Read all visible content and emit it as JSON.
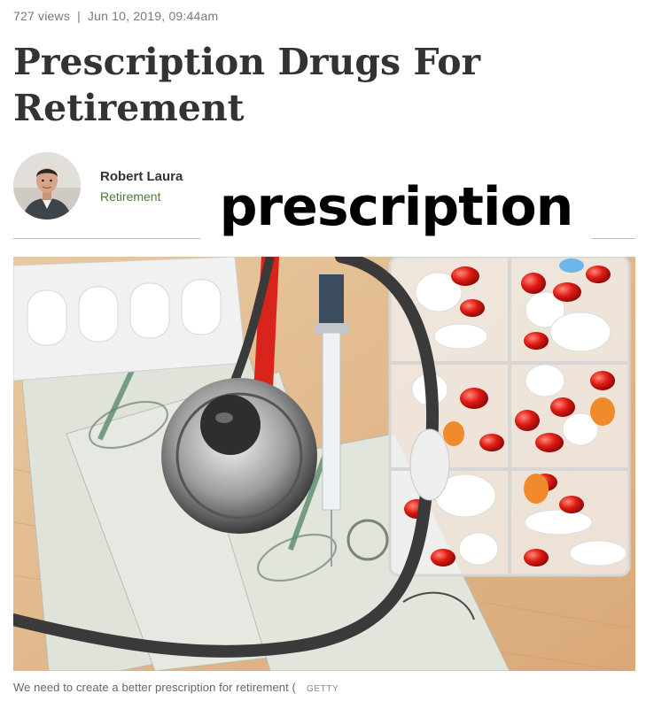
{
  "meta": {
    "views": "727 views",
    "separator": "|",
    "date": "Jun 10, 2019, 09:44am"
  },
  "article": {
    "title": "Prescription Drugs For Retirement"
  },
  "author": {
    "name": "Robert Laura",
    "topic": "Retirement",
    "avatar_icon": "person-avatar-icon"
  },
  "overlay": {
    "word": "prescription"
  },
  "image": {
    "caption": "We need to create a better prescription for retirement (",
    "credit": "GETTY"
  },
  "colors": {
    "meta_text": "#7a7a7a",
    "title_text": "#333333",
    "topic_link": "#4e7a3a",
    "divider": "#bdbdbd"
  }
}
